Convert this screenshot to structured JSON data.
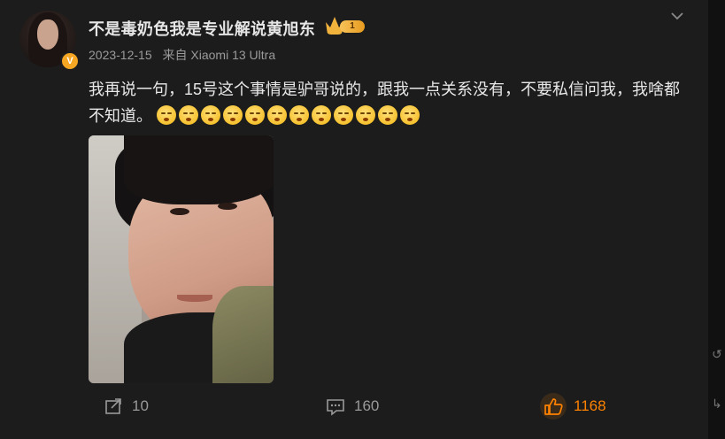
{
  "post": {
    "username": "不是毒奶色我是专业解说黄旭东",
    "level": "1",
    "verified_mark": "V",
    "date": "2023-12-15",
    "source": "来自 Xiaomi 13 Ultra",
    "text": "我再说一句，15号这个事情是驴哥说的，跟我一点关系没有，不要私信问我，我啥都不知道。",
    "emoji_count": 12
  },
  "actions": {
    "repost_count": "10",
    "comment_count": "160",
    "like_count": "1168"
  },
  "colors": {
    "background": "#1c1c1c",
    "text": "#e8e8e8",
    "muted": "#9a9a9a",
    "like_accent": "#ff8200",
    "badge": "#f5a623"
  },
  "icons": [
    "avatar",
    "verified-icon",
    "crown-level-icon",
    "chevron-down-icon",
    "emoji-shush-icon",
    "repost-icon",
    "comment-icon",
    "like-icon"
  ]
}
